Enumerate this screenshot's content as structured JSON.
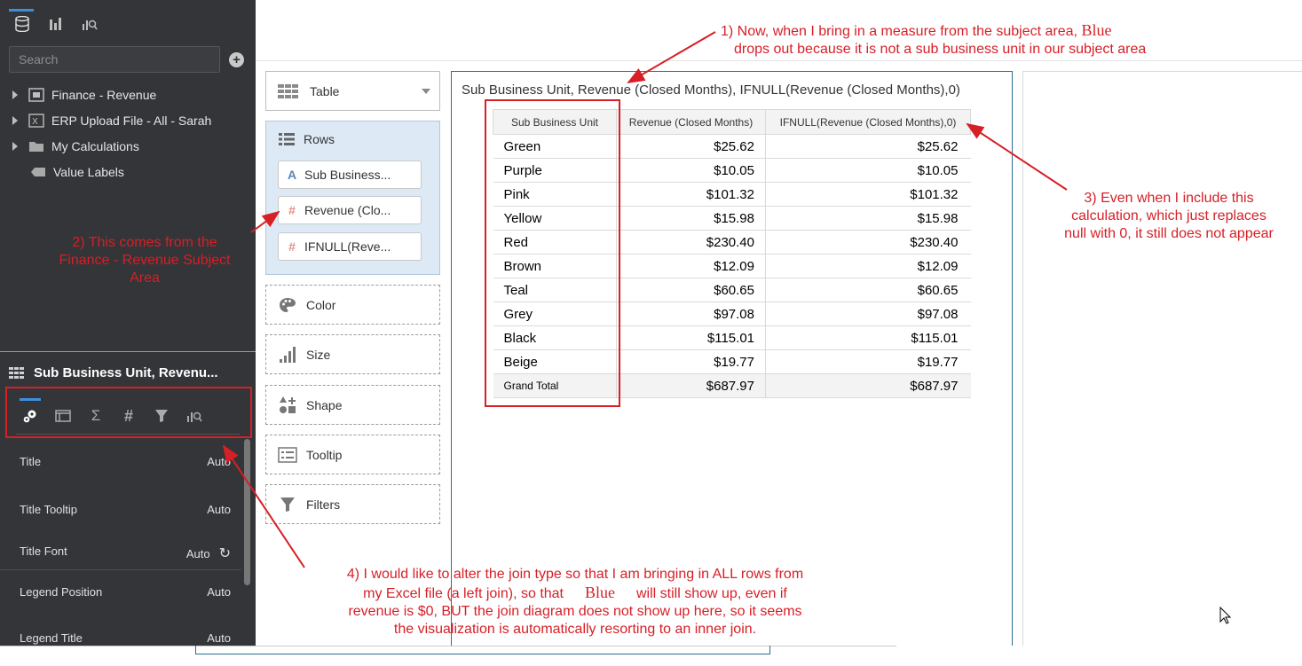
{
  "left_panel": {
    "top_icons": [
      "database-icon",
      "bar-chart-icon",
      "analytics-icon"
    ],
    "search_placeholder": "Search",
    "tree": [
      {
        "label": "Finance - Revenue",
        "icon": "subject-area-icon"
      },
      {
        "label": "ERP Upload File - All - Sarah",
        "icon": "excel-file-icon"
      },
      {
        "label": "My Calculations",
        "icon": "folder-icon"
      },
      {
        "label": "Value Labels",
        "icon": "tag-icon"
      }
    ],
    "viz_title": "Sub Business Unit, Revenu...",
    "properties": [
      {
        "label": "Title",
        "value": "Auto"
      },
      {
        "label": "Title Tooltip",
        "value": "Auto"
      },
      {
        "label": "Title Font",
        "value": "Auto"
      },
      {
        "label": "Legend Position",
        "value": "Auto"
      },
      {
        "label": "Legend Title",
        "value": "Auto"
      }
    ]
  },
  "grammar": {
    "viz_type": "Table",
    "rows_label": "Rows",
    "rows_items": [
      {
        "label": "Sub Business...",
        "type": "A"
      },
      {
        "label": "Revenue (Clo...",
        "type": "#"
      },
      {
        "label": "IFNULL(Reve...",
        "type": "#"
      }
    ],
    "sections": [
      "Color",
      "Size",
      "Shape",
      "Tooltip",
      "Filters"
    ]
  },
  "canvas": {
    "title": "Sub Business Unit, Revenue (Closed Months), IFNULL(Revenue (Closed Months),0)",
    "headers": [
      "Sub Business Unit",
      "Revenue (Closed Months)",
      "IFNULL(Revenue (Closed Months),0)"
    ],
    "rows": [
      [
        "Green",
        "$25.62",
        "$25.62"
      ],
      [
        "Purple",
        "$10.05",
        "$10.05"
      ],
      [
        "Pink",
        "$101.32",
        "$101.32"
      ],
      [
        "Yellow",
        "$15.98",
        "$15.98"
      ],
      [
        "Red",
        "$230.40",
        "$230.40"
      ],
      [
        "Brown",
        "$12.09",
        "$12.09"
      ],
      [
        "Teal",
        "$60.65",
        "$60.65"
      ],
      [
        "Grey",
        "$97.08",
        "$97.08"
      ],
      [
        "Black",
        "$115.01",
        "$115.01"
      ],
      [
        "Beige",
        "$19.77",
        "$19.77"
      ]
    ],
    "total": [
      "Grand Total",
      "$687.97",
      "$687.97"
    ]
  },
  "annotations": {
    "a1_line1": "1) Now, when I bring in a measure from the subject area,",
    "a1_blue": "Blue",
    "a1_line2": "drops out because it is not a sub business unit in our subject area",
    "a2_line1": "2) This comes from the",
    "a2_line2": "Finance - Revenue Subject",
    "a2_line3": "Area",
    "a3_line1": "3) Even when I include this",
    "a3_line2": "calculation, which just replaces",
    "a3_line3": "null with 0, it still does not appear",
    "a4_line1": "4) I would like to alter the join type so that I am bringing in ALL rows from",
    "a4_line2a": "my Excel file (a left join), so that",
    "a4_blue": "Blue",
    "a4_line2b": "will still show up, even if",
    "a4_line3": "revenue is $0, BUT the join diagram does not show up here, so it seems",
    "a4_line4": "the visualization is automatically resorting to an inner join."
  },
  "colors": {
    "annotation_red": "#d71f26",
    "panel_dark": "#333538",
    "rows_bg": "#dde9f4",
    "accent_blue": "#3e8ede"
  }
}
